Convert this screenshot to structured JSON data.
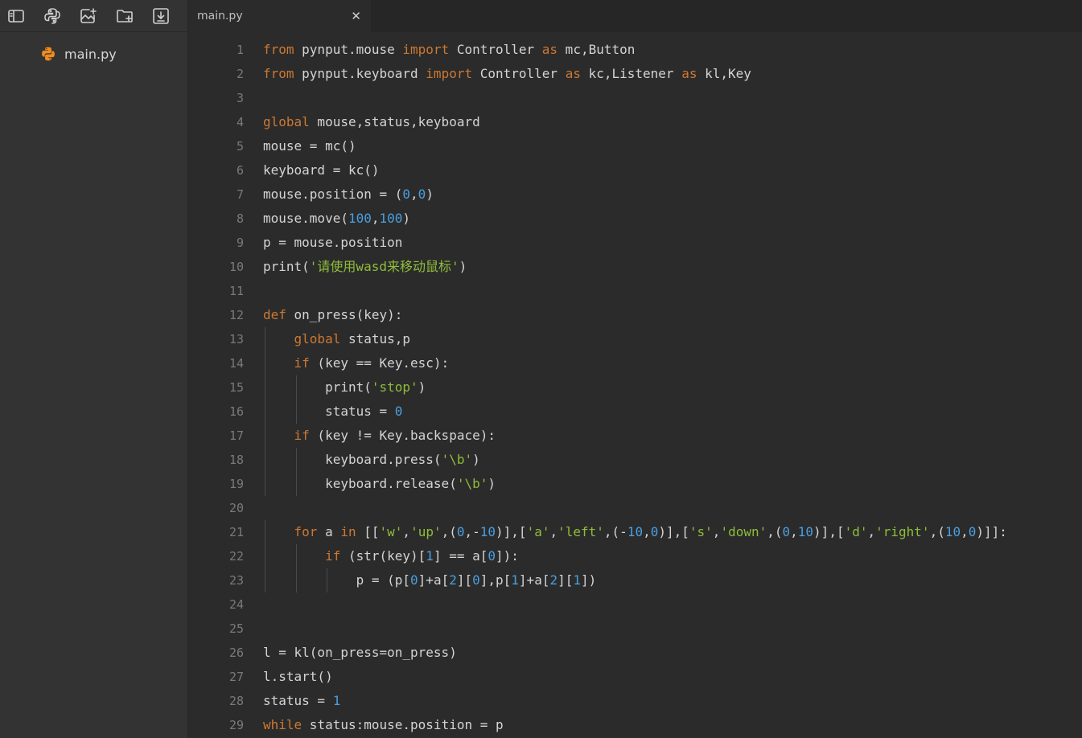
{
  "sidebar": {
    "toolbar": [
      {
        "name": "sidebar-toggle-icon"
      },
      {
        "name": "python-icon"
      },
      {
        "name": "image-add-icon"
      },
      {
        "name": "folder-add-icon"
      },
      {
        "name": "download-icon"
      }
    ],
    "file": {
      "label": "main.py",
      "icon": "python-file-icon"
    }
  },
  "tab": {
    "label": "main.py",
    "close": "✕"
  },
  "colors": {
    "keyword": "#cc7832",
    "number": "#4a9fe0",
    "string": "#8fbd3a",
    "text": "#d4d4d4",
    "line_number": "#7a7a7a"
  },
  "code": {
    "lines": [
      [
        [
          "kw",
          "from"
        ],
        [
          "t",
          " pynput.mouse "
        ],
        [
          "kw",
          "import"
        ],
        [
          "t",
          " Controller "
        ],
        [
          "kw",
          "as"
        ],
        [
          "t",
          " mc,Button"
        ]
      ],
      [
        [
          "kw",
          "from"
        ],
        [
          "t",
          " pynput.keyboard "
        ],
        [
          "kw",
          "import"
        ],
        [
          "t",
          " Controller "
        ],
        [
          "kw",
          "as"
        ],
        [
          "t",
          " kc,Listener "
        ],
        [
          "kw",
          "as"
        ],
        [
          "t",
          " kl,Key"
        ]
      ],
      [],
      [
        [
          "kw",
          "global"
        ],
        [
          "t",
          " mouse,status,keyboard"
        ]
      ],
      [
        [
          "t",
          "mouse = mc()"
        ]
      ],
      [
        [
          "t",
          "keyboard = kc()"
        ]
      ],
      [
        [
          "t",
          "mouse.position = ("
        ],
        [
          "num",
          "0"
        ],
        [
          "t",
          ","
        ],
        [
          "num",
          "0"
        ],
        [
          "t",
          ")"
        ]
      ],
      [
        [
          "t",
          "mouse.move("
        ],
        [
          "num",
          "100"
        ],
        [
          "t",
          ","
        ],
        [
          "num",
          "100"
        ],
        [
          "t",
          ")"
        ]
      ],
      [
        [
          "t",
          "p = mouse.position"
        ]
      ],
      [
        [
          "t",
          "print("
        ],
        [
          "str",
          "'请使用wasd来移动鼠标'"
        ],
        [
          "t",
          ")"
        ]
      ],
      [],
      [
        [
          "kw",
          "def"
        ],
        [
          "t",
          " on_press(key):"
        ]
      ],
      [
        [
          "t",
          "    "
        ],
        [
          "kw",
          "global"
        ],
        [
          "t",
          " status,p"
        ]
      ],
      [
        [
          "t",
          "    "
        ],
        [
          "kw",
          "if"
        ],
        [
          "t",
          " (key == Key.esc):"
        ]
      ],
      [
        [
          "t",
          "        print("
        ],
        [
          "str",
          "'stop'"
        ],
        [
          "t",
          ")"
        ]
      ],
      [
        [
          "t",
          "        status = "
        ],
        [
          "num",
          "0"
        ]
      ],
      [
        [
          "t",
          "    "
        ],
        [
          "kw",
          "if"
        ],
        [
          "t",
          " (key != Key.backspace):"
        ]
      ],
      [
        [
          "t",
          "        keyboard.press("
        ],
        [
          "str",
          "'\\b'"
        ],
        [
          "t",
          ")"
        ]
      ],
      [
        [
          "t",
          "        keyboard.release("
        ],
        [
          "str",
          "'\\b'"
        ],
        [
          "t",
          ")"
        ]
      ],
      [],
      [
        [
          "t",
          "    "
        ],
        [
          "kw",
          "for"
        ],
        [
          "t",
          " a "
        ],
        [
          "kw",
          "in"
        ],
        [
          "t",
          " [["
        ],
        [
          "str",
          "'w'"
        ],
        [
          "t",
          ","
        ],
        [
          "str",
          "'up'"
        ],
        [
          "t",
          ",("
        ],
        [
          "num",
          "0"
        ],
        [
          "t",
          ",-"
        ],
        [
          "num",
          "10"
        ],
        [
          "t",
          ")],["
        ],
        [
          "str",
          "'a'"
        ],
        [
          "t",
          ","
        ],
        [
          "str",
          "'left'"
        ],
        [
          "t",
          ",(-"
        ],
        [
          "num",
          "10"
        ],
        [
          "t",
          ","
        ],
        [
          "num",
          "0"
        ],
        [
          "t",
          ")],["
        ],
        [
          "str",
          "'s'"
        ],
        [
          "t",
          ","
        ],
        [
          "str",
          "'down'"
        ],
        [
          "t",
          ",("
        ],
        [
          "num",
          "0"
        ],
        [
          "t",
          ","
        ],
        [
          "num",
          "10"
        ],
        [
          "t",
          ")],["
        ],
        [
          "str",
          "'d'"
        ],
        [
          "t",
          ","
        ],
        [
          "str",
          "'right'"
        ],
        [
          "t",
          ",("
        ],
        [
          "num",
          "10"
        ],
        [
          "t",
          ","
        ],
        [
          "num",
          "0"
        ],
        [
          "t",
          ")]]:"
        ]
      ],
      [
        [
          "t",
          "        "
        ],
        [
          "kw",
          "if"
        ],
        [
          "t",
          " (str(key)["
        ],
        [
          "num",
          "1"
        ],
        [
          "t",
          "] == a["
        ],
        [
          "num",
          "0"
        ],
        [
          "t",
          "]):"
        ]
      ],
      [
        [
          "t",
          "            p = (p["
        ],
        [
          "num",
          "0"
        ],
        [
          "t",
          "]+a["
        ],
        [
          "num",
          "2"
        ],
        [
          "t",
          "]["
        ],
        [
          "num",
          "0"
        ],
        [
          "t",
          "],p["
        ],
        [
          "num",
          "1"
        ],
        [
          "t",
          "]+a["
        ],
        [
          "num",
          "2"
        ],
        [
          "t",
          "]["
        ],
        [
          "num",
          "1"
        ],
        [
          "t",
          "])"
        ]
      ],
      [],
      [],
      [
        [
          "t",
          "l = kl(on_press=on_press)"
        ]
      ],
      [
        [
          "t",
          "l.start()"
        ]
      ],
      [
        [
          "t",
          "status = "
        ],
        [
          "num",
          "1"
        ]
      ],
      [
        [
          "kw",
          "while"
        ],
        [
          "t",
          " status:mouse.position = p"
        ]
      ]
    ]
  }
}
